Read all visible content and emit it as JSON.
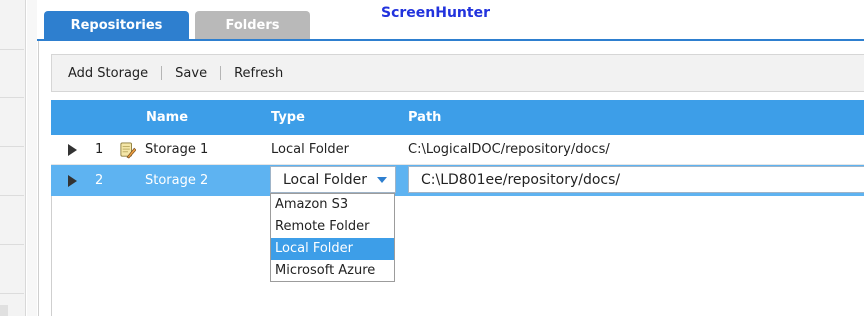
{
  "tabs": {
    "repositories": "Repositories",
    "folders": "Folders"
  },
  "brand": "ScreenHunter",
  "toolbar": {
    "add_storage": "Add Storage",
    "save": "Save",
    "refresh": "Refresh"
  },
  "grid": {
    "columns": {
      "name": "Name",
      "type": "Type",
      "path": "Path"
    },
    "rows": [
      {
        "id": "1",
        "name": "Storage 1",
        "type": "Local Folder",
        "path": "C:\\LogicalDOC/repository/docs/",
        "icon": "note-pencil-icon"
      },
      {
        "id": "2",
        "name": "Storage 2",
        "type": "Local Folder",
        "path": "C:\\LD801ee/repository/docs/"
      }
    ]
  },
  "type_dropdown": {
    "options": [
      "Amazon S3",
      "Remote Folder",
      "Local Folder",
      "Microsoft Azure"
    ],
    "selected": "Local Folder"
  },
  "colors": {
    "accent": "#2e7fcf",
    "header": "#3d9ee8",
    "selected_row": "#5eb3f1",
    "brand_text": "#2233dd"
  }
}
